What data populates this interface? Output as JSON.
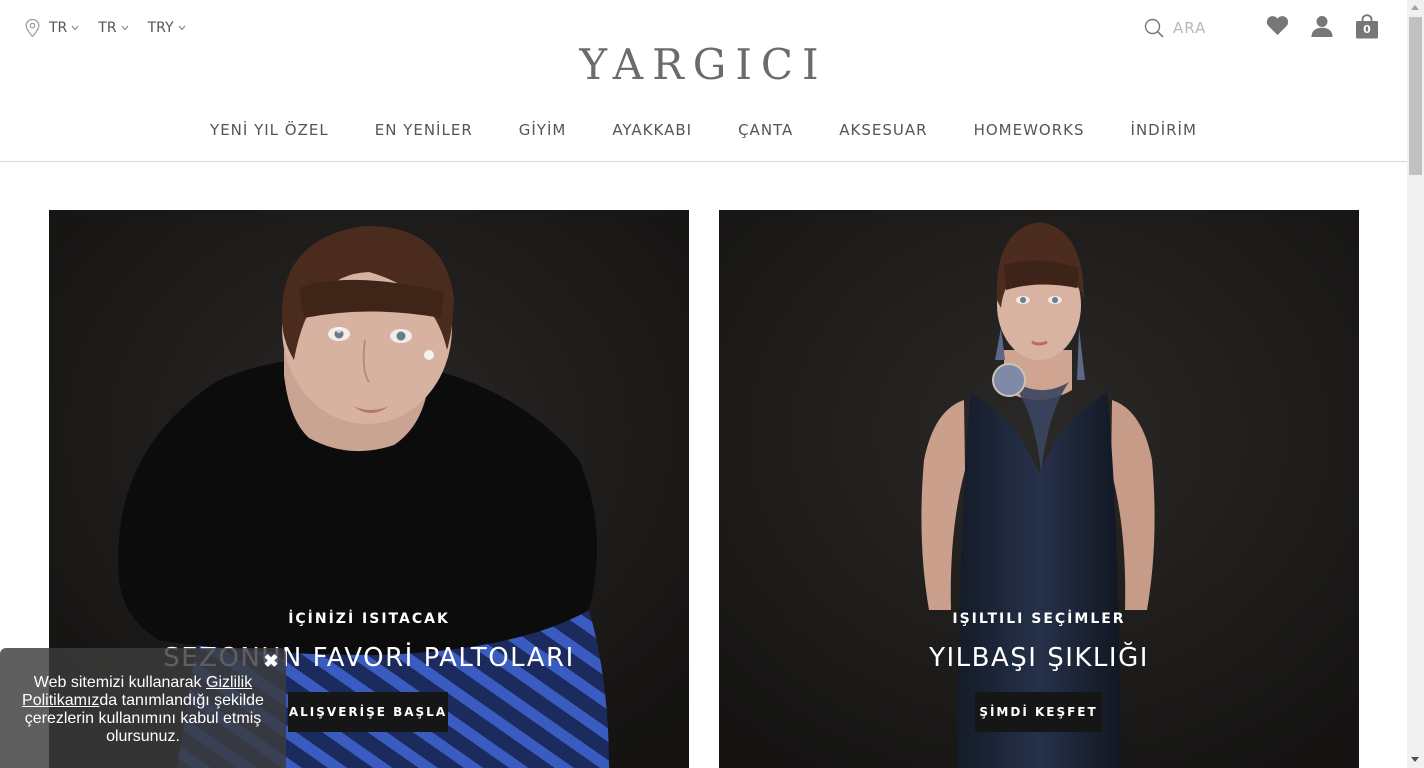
{
  "header": {
    "location_icon": "map-pin-icon",
    "selectors": [
      {
        "label": "TR"
      },
      {
        "label": "TR"
      },
      {
        "label": "TRY"
      }
    ],
    "logo": "YARGICI",
    "search_label": "ARA",
    "cart_count": "0"
  },
  "nav": {
    "items": [
      {
        "label": "YENİ YIL ÖZEL"
      },
      {
        "label": "EN YENİLER"
      },
      {
        "label": "GİYİM"
      },
      {
        "label": "AYAKKABI"
      },
      {
        "label": "ÇANTA"
      },
      {
        "label": "AKSESUAR"
      },
      {
        "label": "HOMEWORKS"
      },
      {
        "label": "İNDİRİM"
      }
    ]
  },
  "banners": [
    {
      "kicker": "İÇİNİZİ ISITACAK",
      "headline": "SEZONUN FAVORİ PALTOLARI",
      "cta": "ALIŞVERİŞE BAŞLA"
    },
    {
      "kicker": "IŞILTILI SEÇİMLER",
      "headline": "YILBAŞI ŞIKLIĞI",
      "cta": "ŞİMDİ KEŞFET"
    }
  ],
  "cookie": {
    "text_before": "Web sitemizi kullanarak ",
    "link": "Gizlilik Politikamız",
    "text_after": "da tanımlandığı şekilde çerezlerin kullanımını kabul etmiş olursunuz.",
    "close_icon": "close-icon"
  },
  "colors": {
    "text": "#444444",
    "logo": "#6b6b6b",
    "cta_bg": "#161616",
    "banner_bg": "#1d1b1a",
    "cookie_bg": "#3c3c3c"
  }
}
